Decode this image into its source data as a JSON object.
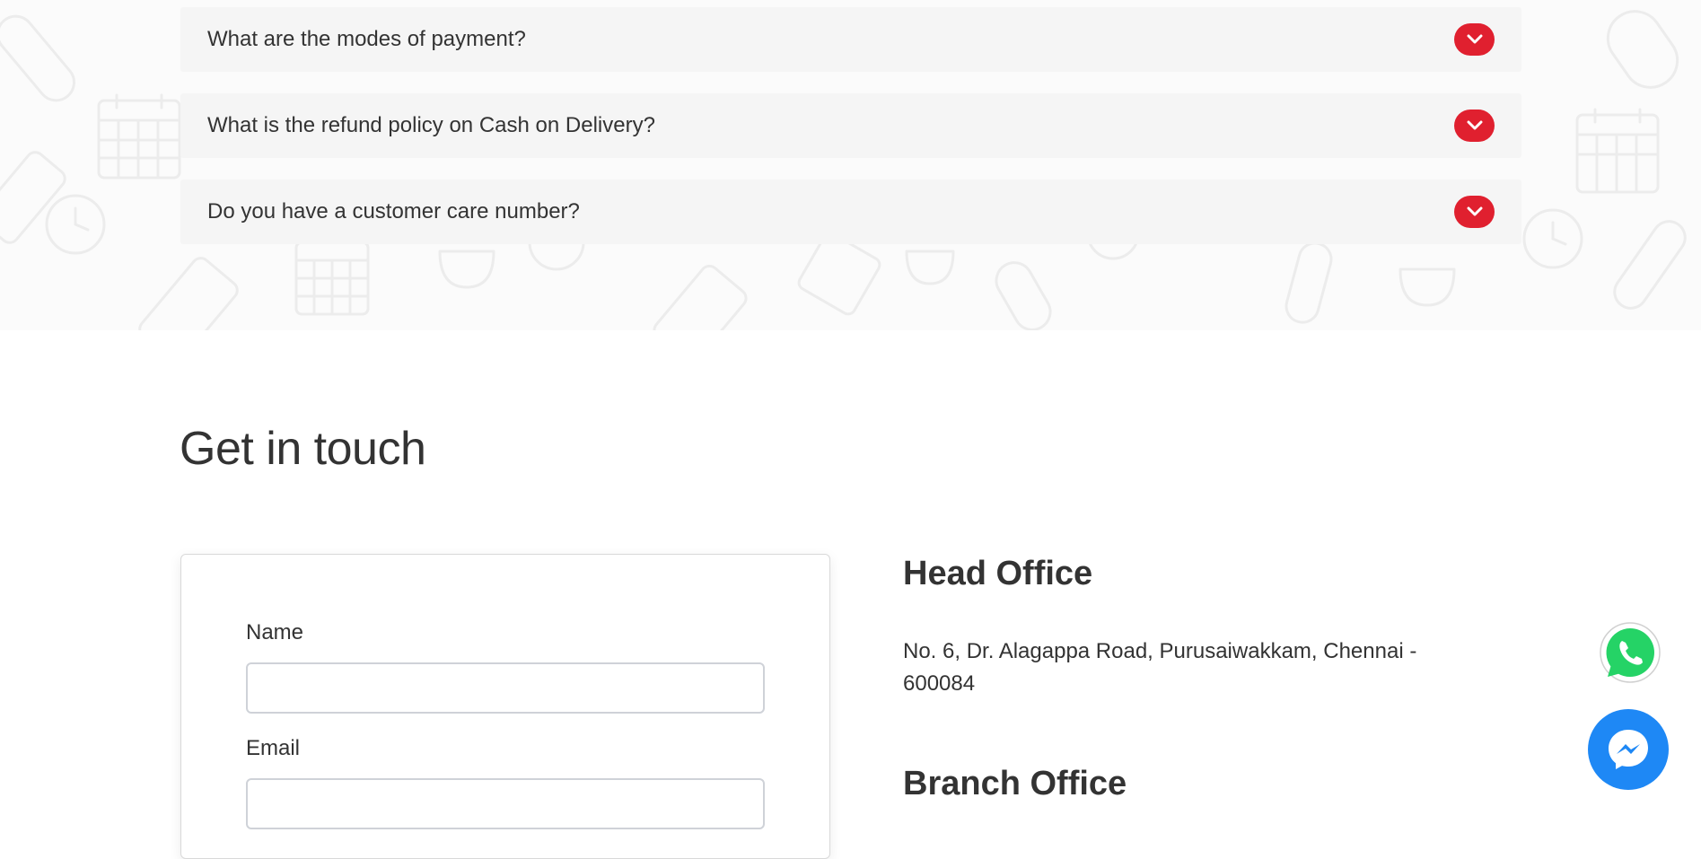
{
  "faq": {
    "items": [
      {
        "question": "What are the modes of payment?"
      },
      {
        "question": "What is the refund policy on Cash on Delivery?"
      },
      {
        "question": "Do you have a customer care number?"
      }
    ]
  },
  "contact": {
    "title": "Get in touch",
    "form": {
      "name_label": "Name",
      "name_value": "",
      "email_label": "Email",
      "email_value": ""
    },
    "head_office": {
      "title": "Head Office",
      "address_line1": "No. 6, Dr. Alagappa Road, Purusaiwakkam, Chennai -",
      "address_line2": "600084"
    },
    "branch_office": {
      "title": "Branch Office"
    }
  },
  "floating": {
    "whatsapp_icon": "whatsapp-icon",
    "messenger_icon": "messenger-icon"
  },
  "colors": {
    "accent": "#e0202f",
    "whatsapp": "#25d366",
    "messenger": "#1e88f5"
  }
}
